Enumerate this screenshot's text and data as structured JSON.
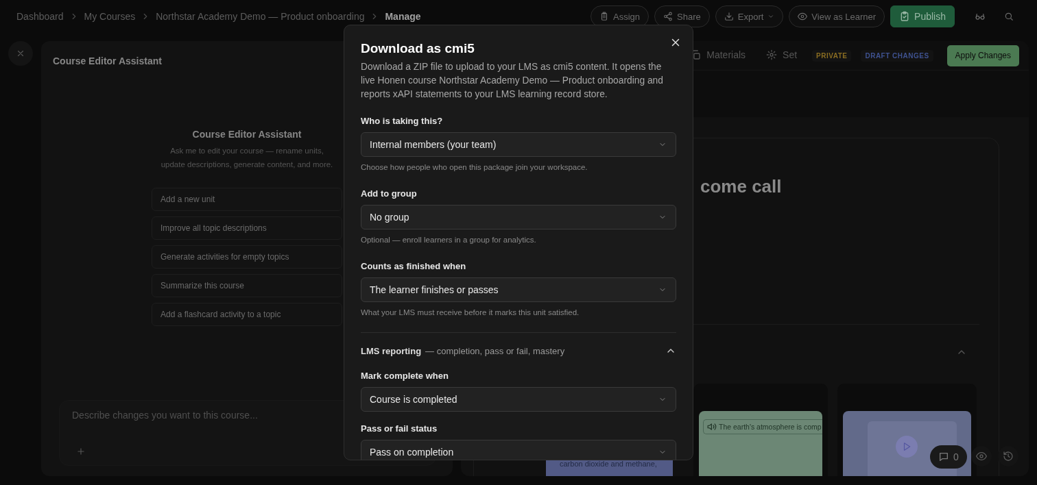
{
  "breadcrumb": [
    {
      "label": "Dashboard",
      "current": false
    },
    {
      "label": "My Courses",
      "current": false
    },
    {
      "label": "Northstar Academy Demo — Product onboarding",
      "current": false
    },
    {
      "label": "Manage",
      "current": true
    }
  ],
  "toolbar": [
    {
      "label": "Assign",
      "kind": "outline"
    },
    {
      "label": "Share",
      "kind": "outline"
    },
    {
      "label": "Export",
      "kind": "dropdown"
    },
    {
      "label": "View as Learner",
      "kind": "outline"
    },
    {
      "label": "Publish",
      "kind": "primary"
    },
    {
      "kind": "icon"
    },
    {
      "kind": "icon"
    }
  ],
  "assistant": {
    "title": "Course Editor Assistant",
    "heading": "Course Editor Assistant",
    "description": "Ask me to edit your course — rename units, update descriptions, generate content, and more.",
    "suggestions": [
      "Add a new unit",
      "Improve all topic descriptions",
      "Generate activities for empty topics",
      "Summarize this course",
      "Add a flashcard activity to a topic"
    ],
    "input": {
      "placeholder": "Describe changes you want to this course..."
    }
  },
  "editor": {
    "tabs": [
      {
        "label": "Materials",
        "selected": false
      },
      {
        "label": "Set",
        "selected": false
      }
    ],
    "badges": [
      {
        "label": "PRIVATE",
        "color": "#8a6d22"
      },
      {
        "label": "DRAFT CHANGES",
        "color": "#3f5290"
      }
    ],
    "apply_button": "Apply Changes",
    "heading": "come call",
    "cards": [
      {
        "kind": "text",
        "caption": "carbon dioxide and methane,"
      },
      {
        "kind": "audio",
        "caption": "The earth's atmosphere is comp"
      },
      {
        "kind": "video"
      }
    ],
    "comments_count": "0"
  },
  "dialog": {
    "title": "Download as cmi5",
    "description": "Download a ZIP file to upload to your LMS as cmi5 content. It opens the live Honen course Northstar Academy Demo — Product onboarding and reports xAPI statements to your LMS learning record store.",
    "fields": [
      {
        "label": "Who is taking this?",
        "value": "Internal members (your team)",
        "help": "Choose how people who open this package join your workspace."
      },
      {
        "label": "Add to group",
        "value": "No group",
        "help": "Optional — enroll learners in a group for analytics."
      },
      {
        "label": "Counts as finished when",
        "value": "The learner finishes or passes",
        "help": "What your LMS must receive before it marks this unit satisfied."
      }
    ],
    "section": {
      "title": "LMS reporting",
      "subtitle": "— completion, pass or fail, mastery",
      "expanded": true,
      "fields": [
        {
          "label": "Mark complete when",
          "value": "Course is completed"
        },
        {
          "label": "Pass or fail status",
          "value": "Pass on completion"
        }
      ]
    }
  }
}
